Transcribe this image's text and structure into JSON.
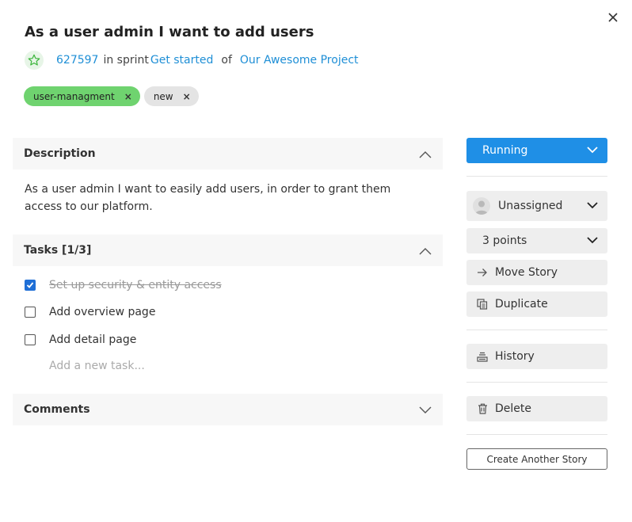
{
  "story": {
    "title": "As a user admin I want to add users",
    "id": "627597",
    "in_sprint_text": "in sprint",
    "sprint": "Get started",
    "of_text": "of",
    "project": "Our Awesome Project",
    "tags": [
      {
        "label": "user-managment",
        "remove": "×"
      },
      {
        "label": "new",
        "remove": "×"
      }
    ]
  },
  "description": {
    "heading": "Description",
    "text": "As a user admin I want to easily add users, in order to grant them access to our platform."
  },
  "tasks": {
    "heading": "Tasks [1/3]",
    "items": [
      {
        "label": "Set up security & entity access",
        "done": true
      },
      {
        "label": "Add overview page",
        "done": false
      },
      {
        "label": "Add detail page",
        "done": false
      }
    ],
    "add_placeholder": "Add a new task..."
  },
  "comments": {
    "heading": "Comments"
  },
  "sidebar": {
    "status": "Running",
    "assignee": "Unassigned",
    "points": "3 points",
    "move_story": "Move Story",
    "duplicate": "Duplicate",
    "history": "History",
    "delete": "Delete",
    "create_another": "Create Another Story"
  },
  "colors": {
    "accent": "#1f8fe6",
    "link": "#1f8fd6",
    "tag_green": "#6fd36f",
    "tag_grey": "#e4e4e4",
    "checkbox": "#1f6fd6"
  },
  "icons": [
    "close-icon",
    "star-icon",
    "chevron-up-icon",
    "chevron-down-icon",
    "checkmark-icon",
    "avatar-icon",
    "arrow-right-icon",
    "duplicate-icon",
    "history-icon",
    "trash-icon"
  ]
}
